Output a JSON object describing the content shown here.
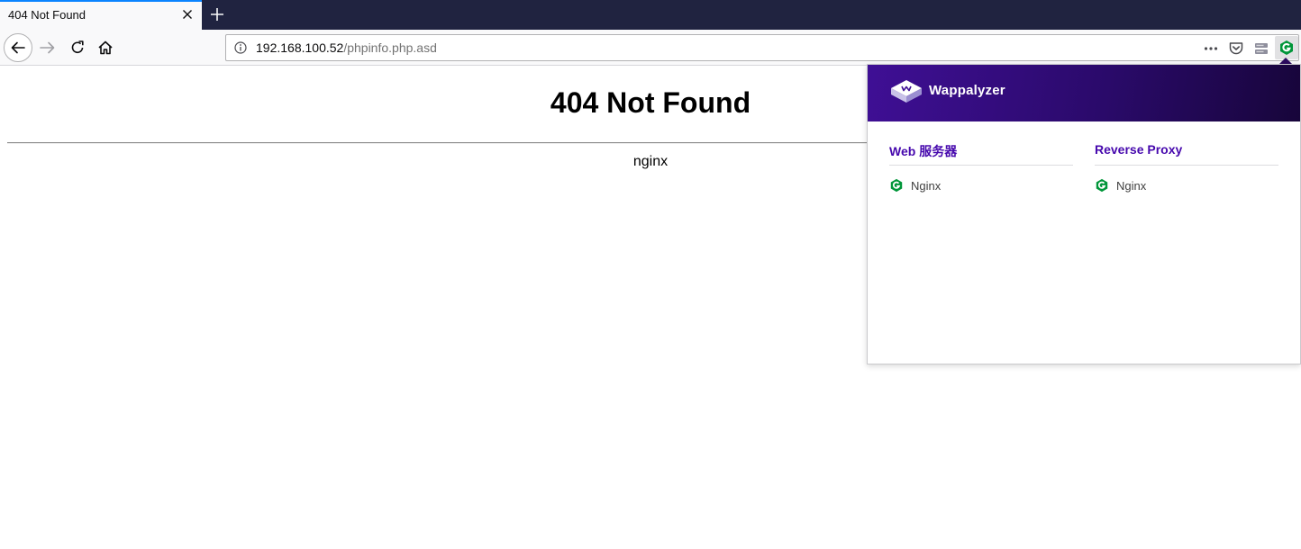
{
  "browser": {
    "tab": {
      "title": "404 Not Found"
    },
    "url": {
      "host": "192.168.100.52",
      "path": "/phpinfo.php.asd"
    }
  },
  "page": {
    "heading": "404 Not Found",
    "footer": "nginx"
  },
  "wappalyzer": {
    "name": "Wappalyzer",
    "categories": [
      {
        "title": "Web 服务器",
        "techs": [
          {
            "name": "Nginx"
          }
        ]
      },
      {
        "title": "Reverse Proxy",
        "techs": [
          {
            "name": "Nginx"
          }
        ]
      }
    ],
    "colors": {
      "header": "#3f0f95",
      "accent": "#4608ad",
      "nginx_green": "#009639"
    }
  }
}
